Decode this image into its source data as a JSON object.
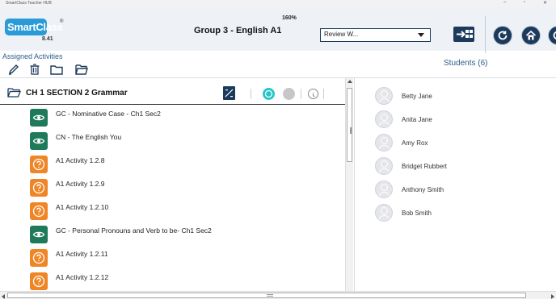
{
  "window": {
    "title": "SmartClass Teacher HUB"
  },
  "brand": {
    "logo_text": "SmartClass",
    "registered": "®",
    "version": "8.41"
  },
  "header": {
    "zoom": "160%",
    "group_title": "Group 3 - English A1",
    "review_select": {
      "value": "Review W..."
    }
  },
  "assigned": {
    "label": "Assigned Activities"
  },
  "section": {
    "title": "CH 1 SECTION 2 Grammar"
  },
  "activities": [
    {
      "label": "GC - Nominative Case - Ch1 Sec2",
      "kind": "view"
    },
    {
      "label": "CN - The English You",
      "kind": "view"
    },
    {
      "label": "A1 Activity 1.2.8",
      "kind": "quiz"
    },
    {
      "label": "A1 Activity 1.2.9",
      "kind": "quiz"
    },
    {
      "label": "A1 Activity 1.2.10",
      "kind": "quiz"
    },
    {
      "label": "GC - Personal Pronouns and Verb to be- Ch1 Sec2",
      "kind": "view"
    },
    {
      "label": "A1 Activity 1.2.11",
      "kind": "quiz"
    },
    {
      "label": "A1 Activity 1.2.12",
      "kind": "quiz"
    }
  ],
  "students": {
    "label": "Students (6)",
    "list": [
      {
        "name": "Betty Jane"
      },
      {
        "name": "Anita Jane"
      },
      {
        "name": "Amy Rox"
      },
      {
        "name": "Bridget Rubbert"
      },
      {
        "name": "Anthony Smith"
      },
      {
        "name": "Bob Smith"
      }
    ]
  },
  "colors": {
    "brand_blue": "#2a9bd6",
    "navy": "#1c3a5c",
    "view_green": "#1e7a5b",
    "quiz_orange": "#f08526",
    "teal": "#29c6c9",
    "label_blue": "#2c5d8a"
  },
  "icons": {
    "edit": "pencil-icon",
    "delete": "trash-icon",
    "folder": "folder-icon",
    "folder_open": "folder-open-icon",
    "view": "eye-icon",
    "quiz": "question-icon",
    "refresh": "refresh-icon",
    "home": "home-icon",
    "export": "export-icon",
    "clock": "clock-icon",
    "calculator": "calculator-icon"
  }
}
